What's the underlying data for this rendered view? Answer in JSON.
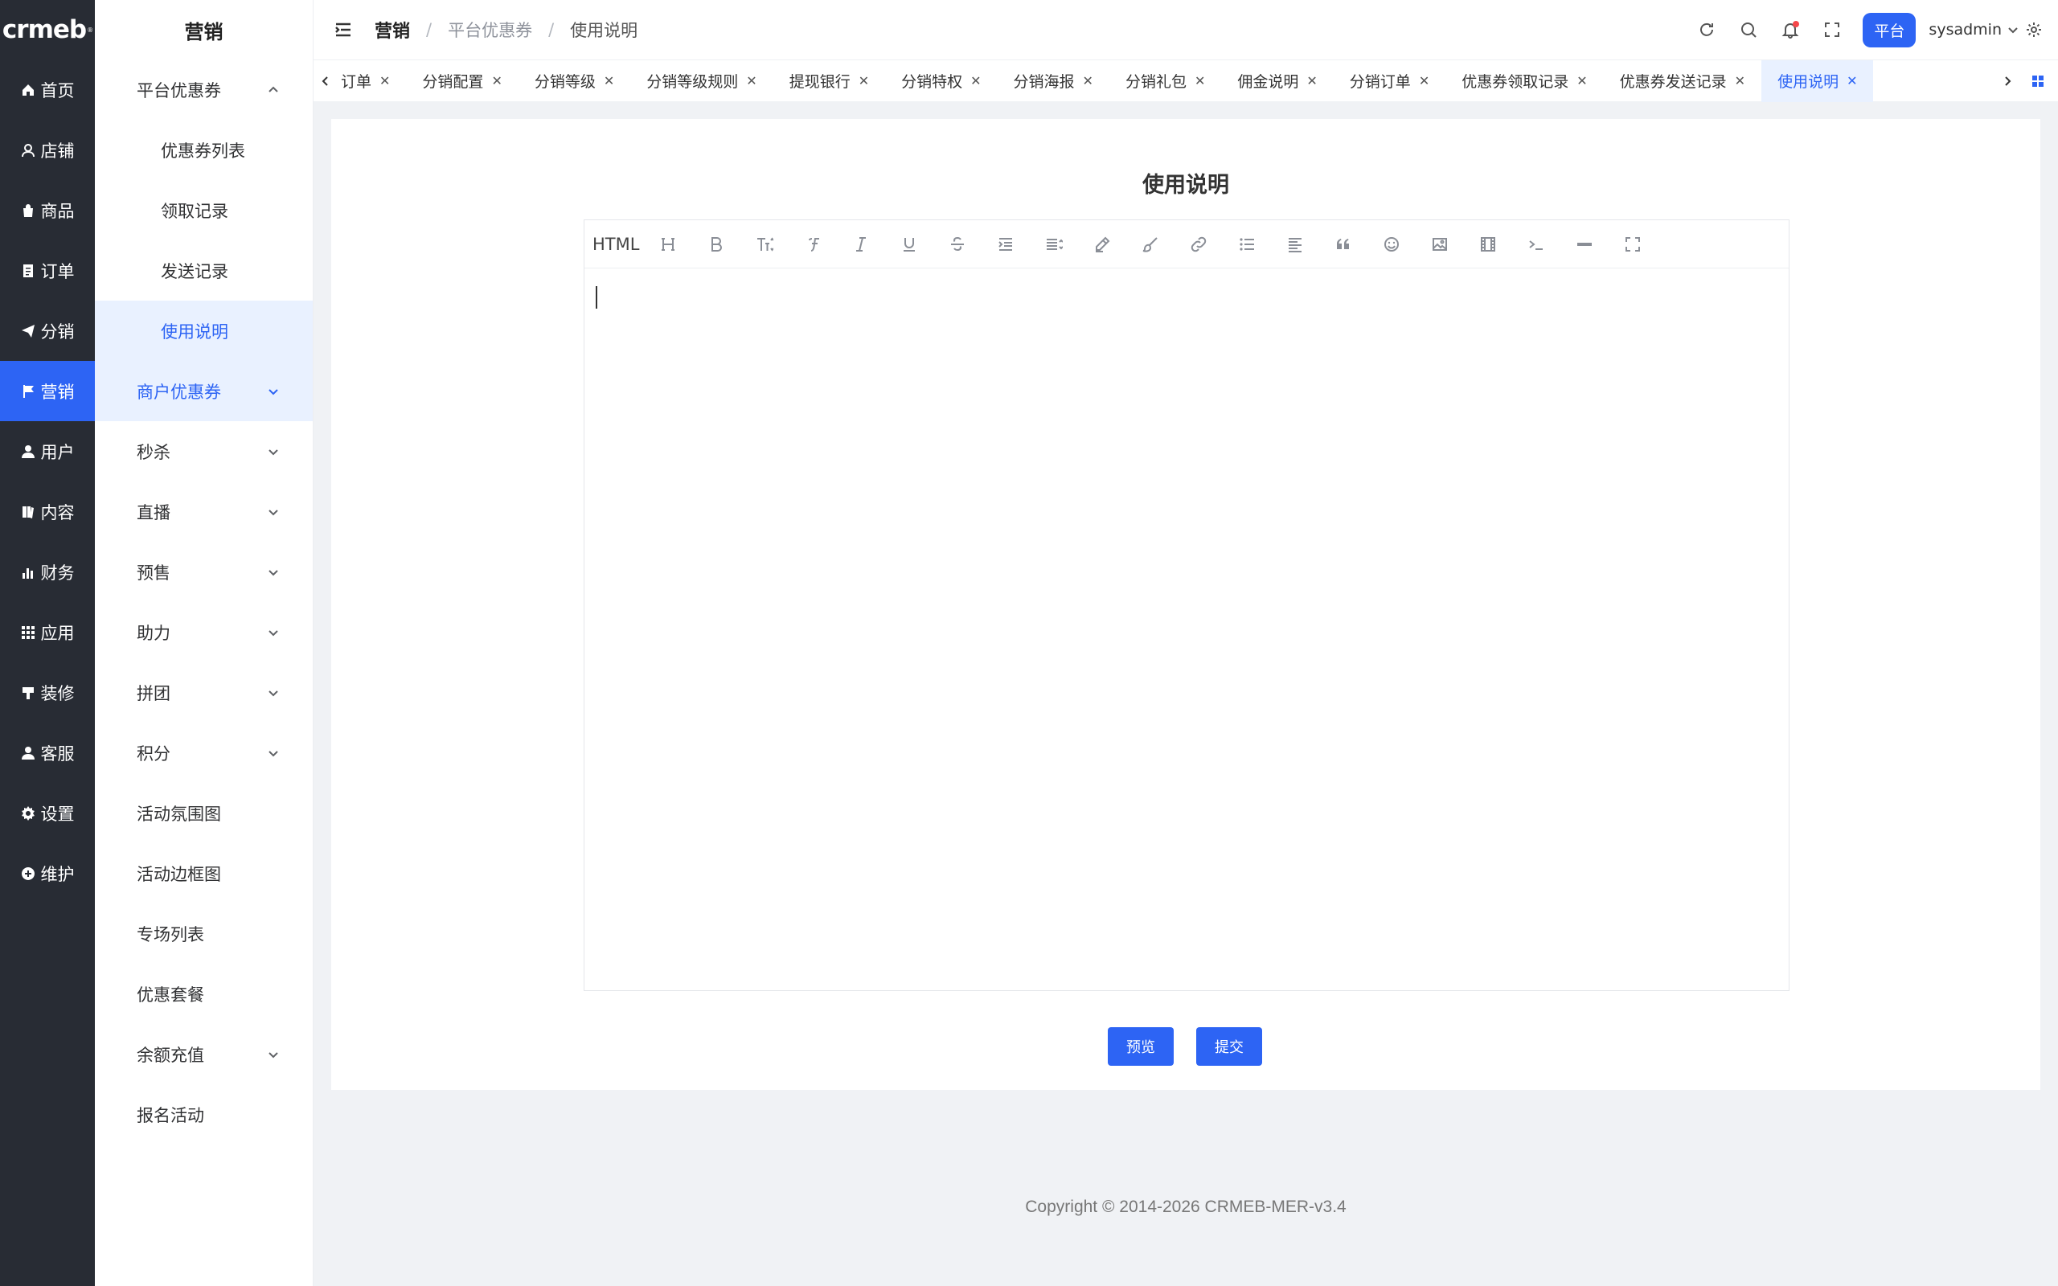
{
  "brand": {
    "logo": "crmeb",
    "mark": "®"
  },
  "rail": [
    {
      "label": "首页",
      "icon": "home-icon"
    },
    {
      "label": "店铺",
      "icon": "store-icon"
    },
    {
      "label": "商品",
      "icon": "bag-icon"
    },
    {
      "label": "订单",
      "icon": "order-icon"
    },
    {
      "label": "分销",
      "icon": "send-icon"
    },
    {
      "label": "营销",
      "icon": "flag-icon",
      "active": true
    },
    {
      "label": "用户",
      "icon": "user-icon"
    },
    {
      "label": "内容",
      "icon": "book-icon"
    },
    {
      "label": "财务",
      "icon": "bar-chart-icon"
    },
    {
      "label": "应用",
      "icon": "grid-icon"
    },
    {
      "label": "装修",
      "icon": "brush-icon"
    },
    {
      "label": "客服",
      "icon": "service-icon"
    },
    {
      "label": "设置",
      "icon": "gear-icon"
    },
    {
      "label": "维护",
      "icon": "plus-circle-icon"
    }
  ],
  "submenu": {
    "title": "营销",
    "items": [
      {
        "label": "平台优惠券",
        "expanded": true
      },
      {
        "label": "优惠券列表",
        "child": true
      },
      {
        "label": "领取记录",
        "child": true
      },
      {
        "label": "发送记录",
        "child": true
      },
      {
        "label": "使用说明",
        "child": true,
        "active": true
      },
      {
        "label": "商户优惠券",
        "hasArrow": true,
        "highlight": true
      },
      {
        "label": "秒杀",
        "hasArrow": true
      },
      {
        "label": "直播",
        "hasArrow": true
      },
      {
        "label": "预售",
        "hasArrow": true
      },
      {
        "label": "助力",
        "hasArrow": true
      },
      {
        "label": "拼团",
        "hasArrow": true
      },
      {
        "label": "积分",
        "hasArrow": true
      },
      {
        "label": "活动氛围图"
      },
      {
        "label": "活动边框图"
      },
      {
        "label": "专场列表"
      },
      {
        "label": "优惠套餐"
      },
      {
        "label": "余额充值",
        "hasArrow": true
      },
      {
        "label": "报名活动"
      }
    ]
  },
  "header": {
    "breadcrumb": [
      "营销",
      "平台优惠券",
      "使用说明"
    ],
    "separator": "/",
    "platform_badge": "平台",
    "username": "sysadmin"
  },
  "tabs": [
    {
      "label": "订单"
    },
    {
      "label": "分销配置"
    },
    {
      "label": "分销等级"
    },
    {
      "label": "分销等级规则"
    },
    {
      "label": "提现银行"
    },
    {
      "label": "分销特权"
    },
    {
      "label": "分销海报"
    },
    {
      "label": "分销礼包"
    },
    {
      "label": "佣金说明"
    },
    {
      "label": "分销订单"
    },
    {
      "label": "优惠券领取记录"
    },
    {
      "label": "优惠券发送记录"
    },
    {
      "label": "使用说明",
      "active": true
    }
  ],
  "tab_close_glyph": "✕",
  "page": {
    "title": "使用说明",
    "toolbar_html_label": "HTML",
    "preview_button": "预览",
    "submit_button": "提交"
  },
  "footer": "Copyright © 2014-2026 CRMEB-MER-v3.4",
  "colors": {
    "accent": "#2d64f4",
    "rail_bg": "#282c34",
    "active_bg": "#e9f1ff"
  }
}
